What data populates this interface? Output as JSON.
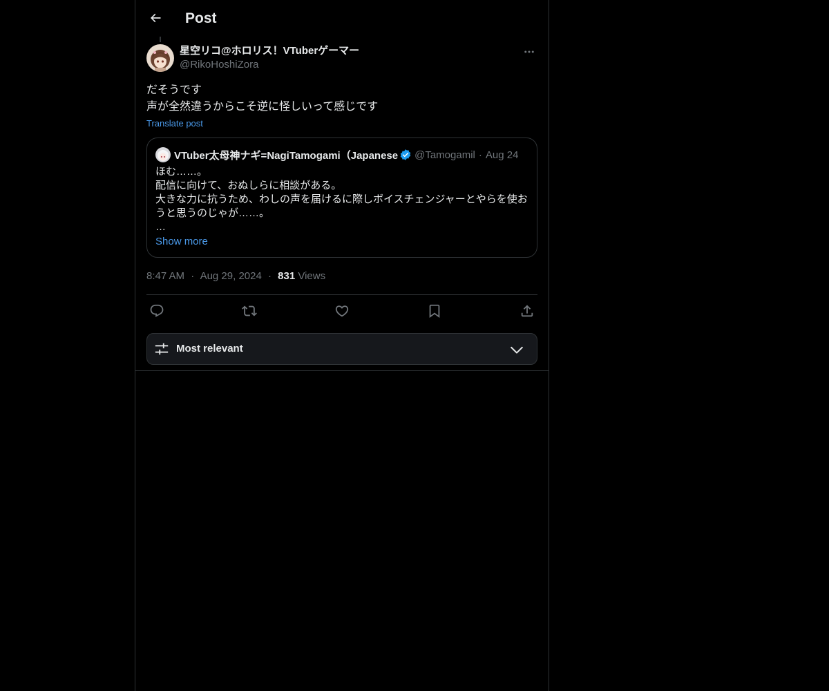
{
  "header": {
    "title": "Post",
    "back_icon": "arrow-left-icon"
  },
  "post": {
    "author": {
      "display_name": "星空リコ@ホロリス！VTuberゲーマー",
      "handle": "@RikoHoshiZora"
    },
    "text_lines": [
      "だそうです",
      "声が全然違うからこそ逆に怪しいって感じです"
    ],
    "translate_label": "Translate post",
    "quote": {
      "display_name": "VTuber太母神ナギ=NagiTamogami（Japanese",
      "verified": true,
      "handle": "@Tamogamil",
      "separator": "·",
      "date": "Aug 24",
      "text_lines": [
        "ほむ……。",
        "配信に向けて、おぬしらに相談がある。",
        "大きな力に抗うため、わしの声を届けるに際しボイスチェンジャーとやらを使お",
        "うと思うのじゃが……。",
        "…"
      ],
      "show_more_label": "Show more"
    },
    "meta": {
      "time": "8:47 AM",
      "separator": "·",
      "date": "Aug 29, 2024",
      "views_count": "831",
      "views_label": "Views"
    },
    "actions": [
      {
        "name": "reply",
        "icon": "reply-icon"
      },
      {
        "name": "repost",
        "icon": "repost-icon"
      },
      {
        "name": "like",
        "icon": "heart-icon"
      },
      {
        "name": "bookmark",
        "icon": "bookmark-icon"
      },
      {
        "name": "share",
        "icon": "share-icon"
      }
    ]
  },
  "sort": {
    "label": "Most relevant",
    "icon": "sliders-icon",
    "chevron": "chevron-down-icon"
  },
  "colors": {
    "background": "#000000",
    "text_primary": "#e7e9ea",
    "text_secondary": "#71767b",
    "link": "#4a99e9",
    "border": "#2f3336",
    "verified": "#1d9bf0"
  }
}
